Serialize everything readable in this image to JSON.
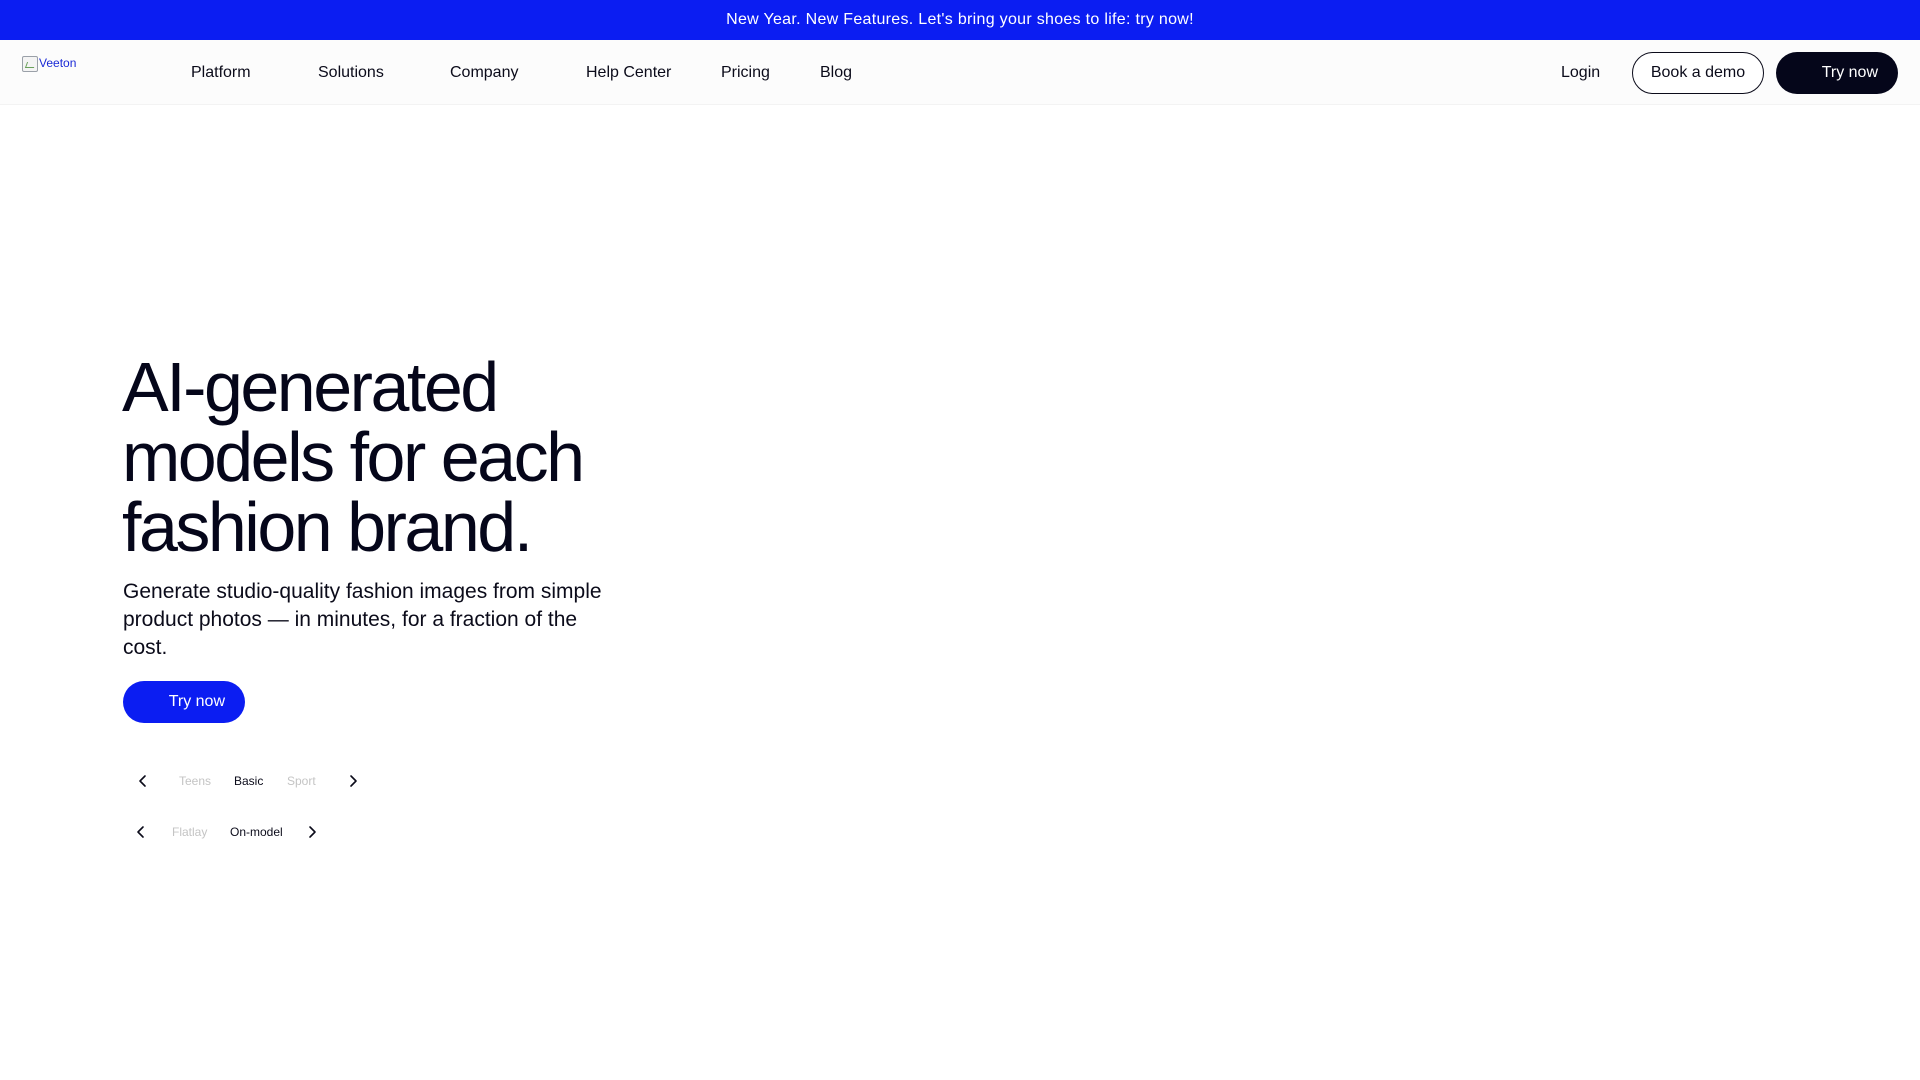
{
  "announcement": {
    "text": "New Year. New Features. Let's bring your shoes to life: try now!"
  },
  "header": {
    "logo_alt": "Veeton",
    "nav": [
      {
        "label": "Platform"
      },
      {
        "label": "Solutions"
      },
      {
        "label": "Company"
      },
      {
        "label": "Help Center"
      },
      {
        "label": "Pricing"
      },
      {
        "label": "Blog"
      }
    ],
    "login_label": "Login",
    "book_demo_label": "Book a demo",
    "try_now_label": "Try now"
  },
  "hero": {
    "title_lines": [
      "AI-generated",
      "models for each",
      "fashion brand."
    ],
    "subtitle": "Generate studio-quality fashion images from simple product photos — in minutes, for a fraction of the cost.",
    "cta_label": "Try now"
  },
  "carousels": [
    {
      "options": [
        "Teens",
        "Basic",
        "Sport"
      ],
      "selected": "Basic"
    },
    {
      "options": [
        "Flatlay",
        "On-model"
      ],
      "selected": "On-model"
    }
  ],
  "colors": {
    "brand_blue": "#0b1df2",
    "dark": "#05061a",
    "muted": "#c4c4c4"
  },
  "icons": {
    "prev": "chevron-left-icon",
    "next": "chevron-right-icon",
    "logo": "broken-image-icon"
  }
}
